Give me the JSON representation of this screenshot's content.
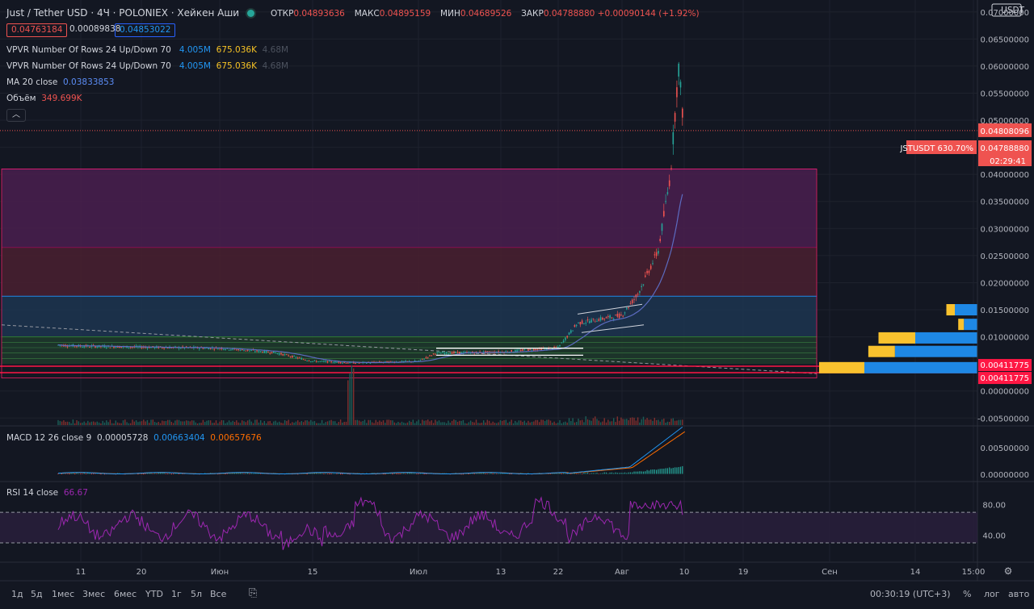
{
  "header": {
    "symbol": "Just / Tether USD · 4Ч · POLONIEX · Хейкен Аши",
    "ohlc": [
      {
        "label": "ОТКР",
        "value": "0.04893636"
      },
      {
        "label": "МАКС",
        "value": "0.04895159"
      },
      {
        "label": "МИН",
        "value": "0.04689526"
      },
      {
        "label": "ЗАКР",
        "value": "0.04788880"
      }
    ],
    "change": "+0.00090144 (+1.92%)",
    "sell_price": "0.04763184",
    "spread": "0.00089838",
    "buy_price": "0.04853022"
  },
  "legends": {
    "vpvr1": {
      "name": "VPVR Number Of Rows 24 Up/Down 70",
      "up": "4.005M",
      "down": "675.036K",
      "total": "4.68M"
    },
    "vpvr2": {
      "name": "VPVR Number Of Rows 24 Up/Down 70",
      "up": "4.005M",
      "down": "675.036K",
      "total": "4.68M"
    },
    "ma": {
      "name": "MA 20 close",
      "value": "0.03833853"
    },
    "volume": {
      "name": "Объём",
      "value": "349.699K"
    },
    "macd": {
      "name": "MACD 12 26 close 9",
      "hist": "0.00005728",
      "macd": "0.00663404",
      "signal": "0.00657676"
    },
    "rsi": {
      "name": "RSI 14 close",
      "value": "66.67"
    }
  },
  "collapse_icon": "chevron-up-icon",
  "price_axis": {
    "currency": "USDT",
    "ticks": [
      "0.07000000",
      "0.06500000",
      "0.06000000",
      "0.05500000",
      "0.05000000",
      "0.04500000",
      "0.04000000",
      "0.03500000",
      "0.03000000",
      "0.02500000",
      "0.02000000",
      "0.01500000",
      "0.01000000",
      "0.00500000",
      "0.00000000",
      "-0.00500000"
    ],
    "last_price_label": "0.04808096",
    "close_label": "0.04788880",
    "symbol_badge": "JSTUSDT 630.70%",
    "countdown": "02:29:41",
    "red_line_labels": [
      "0.00411775",
      "0.00411775"
    ]
  },
  "macd_axis": [
    "0.00500000",
    "0.00000000"
  ],
  "rsi_axis": [
    "80.00",
    "40.00"
  ],
  "time_axis": [
    "11",
    "20",
    "Июн",
    "15",
    "Июл",
    "13",
    "22",
    "Авг",
    "10",
    "19",
    "Сен",
    "14",
    "15:00"
  ],
  "bottom": {
    "ranges": [
      "1д",
      "5д",
      "1мес",
      "3мес",
      "6мес",
      "YTD",
      "1г",
      "5л",
      "Все"
    ],
    "clock": "00:30:19 (UTC+3)",
    "pct": "%",
    "log": "лог",
    "auto": "авто"
  },
  "chart_data": {
    "type": "candlestick",
    "title": "Just / Tether USD · 4Ч · POLONIEX · Хейкен Аши",
    "ylim": [
      -0.0063,
      0.0722
    ],
    "x_ticks": [
      "11",
      "20",
      "Июн",
      "15",
      "Июл",
      "13",
      "22",
      "Авг",
      "10",
      "19",
      "Сен",
      "14",
      "15:00"
    ],
    "price_series": {
      "x": [
        "11",
        "20",
        "Июн",
        "15",
        "Июл",
        "13",
        "22",
        "Авг",
        "10"
      ],
      "close": [
        0.0085,
        0.0082,
        0.0078,
        0.0055,
        0.0068,
        0.0072,
        0.012,
        0.02,
        0.0479
      ]
    },
    "ma20": {
      "name": "MA 20 close",
      "last": 0.03833853
    },
    "last_price": 0.04808096,
    "support_line": 0.00411775,
    "vpvr_zones": [
      {
        "from": 0.0265,
        "to": 0.041,
        "color": "#7b1fa2"
      },
      {
        "from": 0.0175,
        "to": 0.0265,
        "color": "#880e4f"
      },
      {
        "from": 0.01,
        "to": 0.0175,
        "color": "#1e88e5"
      },
      {
        "from": 0.005,
        "to": 0.01,
        "color": "#2e7d32"
      }
    ],
    "vpvr_profile": [
      {
        "price": 0.0098,
        "up": 0.65,
        "down": 0.55
      },
      {
        "price": 0.0073,
        "up": 0.47,
        "down": 0.73
      },
      {
        "price": 0.0043,
        "up": 0.8,
        "down": 1.0
      },
      {
        "price": 0.015,
        "up": 0.15,
        "down": 0.2
      },
      {
        "price": 0.0123,
        "up": 0.1,
        "down": 0.12
      }
    ],
    "rsi": {
      "name": "RSI 14 close",
      "value": 66.67,
      "upper": 70,
      "lower": 30
    },
    "macd": {
      "name": "MACD 12 26 close 9",
      "macd": 0.00663404,
      "signal": 0.00657676,
      "hist": 5.728e-05
    }
  },
  "colors": {
    "bg": "#131722",
    "up": "#26a69a",
    "down": "#ef5350",
    "ma": "#5c6bc0",
    "macd": "#2196f3",
    "signal": "#ff6d00",
    "rsi": "#9c27b0",
    "red_line": "#ff1744"
  }
}
